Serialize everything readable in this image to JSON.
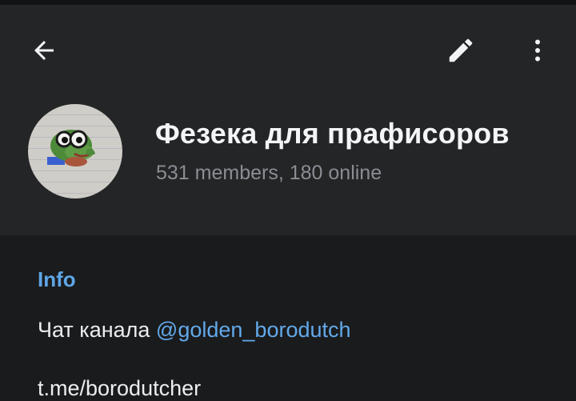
{
  "header": {
    "title": "Фезека для прафисоров",
    "subtitle": "531 members, 180 online",
    "avatar_icon": "pepe-frog-avatar",
    "back_icon": "arrow-left-icon",
    "edit_icon": "pencil-icon",
    "more_icon": "more-vertical-icon"
  },
  "info": {
    "heading": "Info",
    "description_prefix": "Чат канала ",
    "description_mention": "@golden_borodutch",
    "link": "t.me/borodutcher"
  },
  "colors": {
    "accent": "#5ea6e6",
    "header_bg": "#232527",
    "body_bg": "#1a1b1d"
  }
}
